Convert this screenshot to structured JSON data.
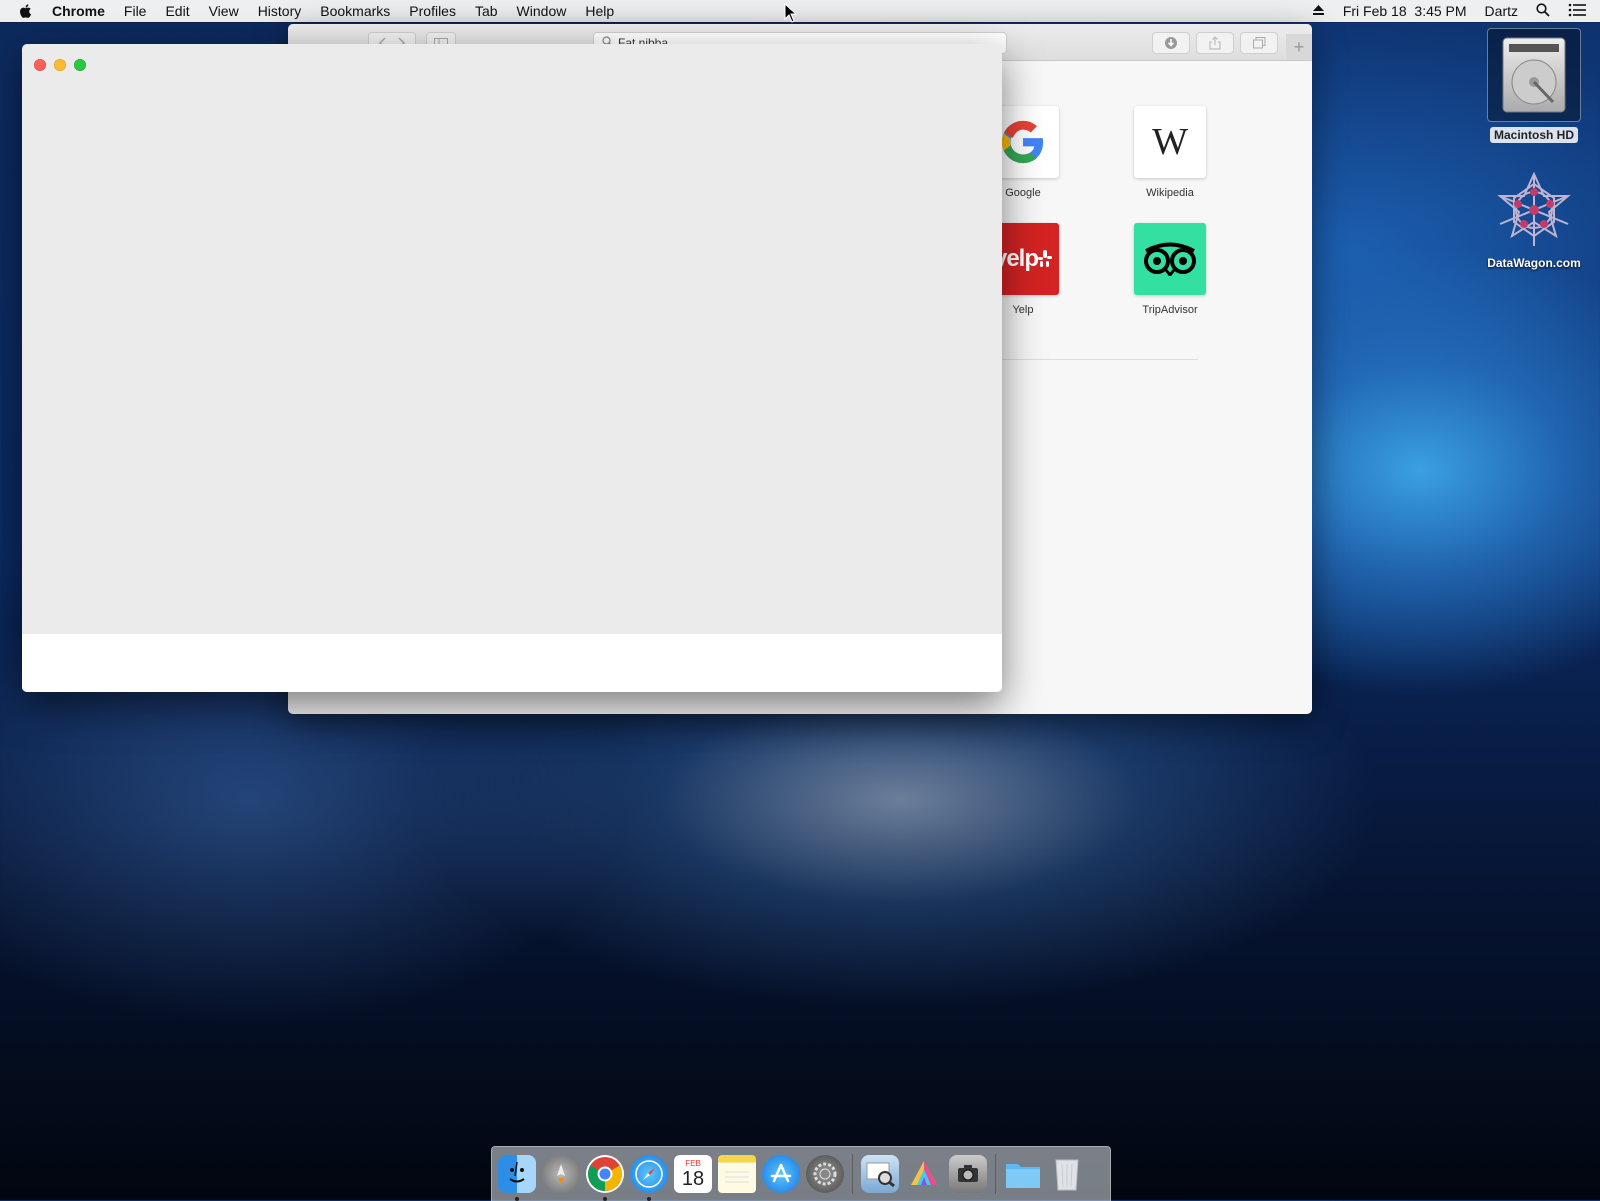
{
  "menubar": {
    "app_name": "Chrome",
    "items": [
      "File",
      "Edit",
      "View",
      "History",
      "Bookmarks",
      "Profiles",
      "Tab",
      "Window",
      "Help"
    ],
    "clock": "Fri Feb 18  3:45 PM",
    "user": "Dartz"
  },
  "safari": {
    "search_text": "Fat nibba",
    "favorites": [
      {
        "label": "Google",
        "logo": "G"
      },
      {
        "label": "Wikipedia",
        "logo": "W"
      },
      {
        "label": "Yelp",
        "logo": "yelp"
      },
      {
        "label": "TripAdvisor",
        "logo": "tripadvisor-owl"
      }
    ]
  },
  "desktop": {
    "hd_label": "Macintosh HD",
    "datawagon_label": "DataWagon.com"
  },
  "dock": {
    "apps": [
      "finder-icon",
      "launchpad-icon",
      "chrome-icon",
      "safari-icon",
      "calendar-icon",
      "notes-icon",
      "app-store-icon",
      "system-preferences-icon",
      "preview-icon",
      "color-picker-icon",
      "screenshot-icon",
      "downloads-folder-icon",
      "trash-icon"
    ],
    "calendar_month": "FEB",
    "calendar_day": "18"
  },
  "colors": {
    "close": "#fc5f57",
    "minimize": "#fdbc2e",
    "zoom": "#28c840",
    "yelp": "#d32323",
    "tripadvisor": "#34e0a1"
  }
}
